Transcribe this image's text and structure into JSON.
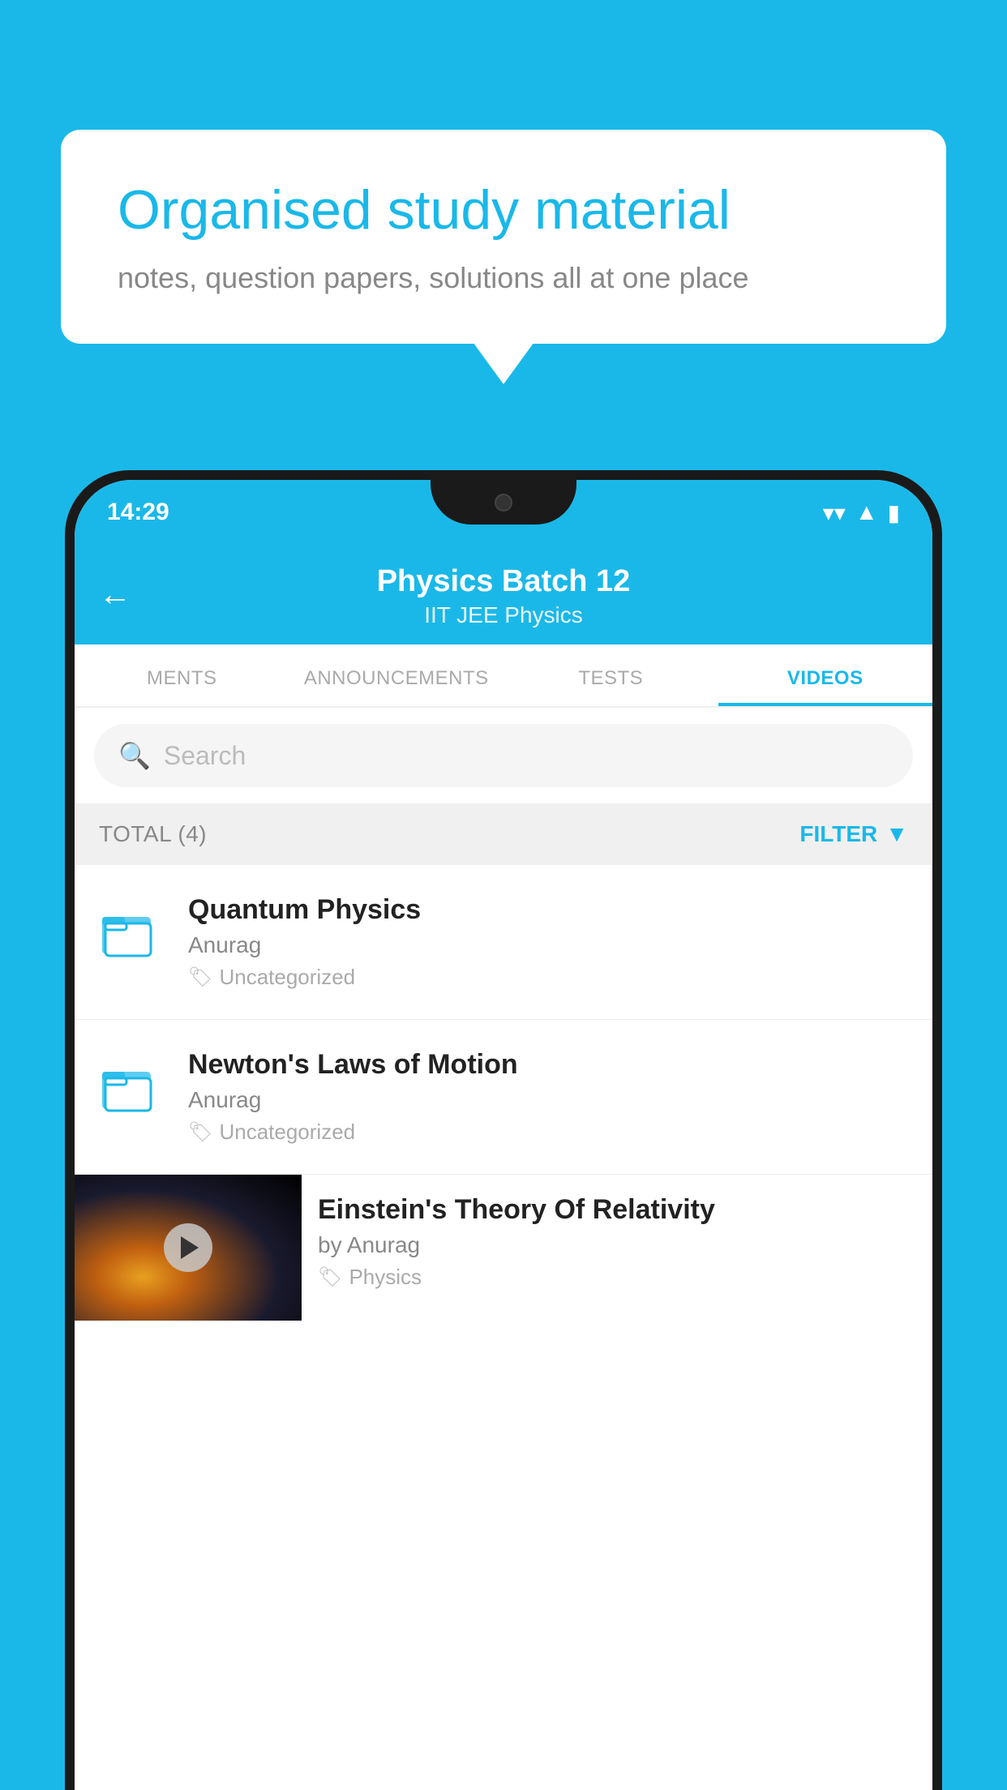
{
  "background": {
    "color": "#1ab8e8"
  },
  "bubble": {
    "title": "Organised study material",
    "subtitle": "notes, question papers, solutions all at one place"
  },
  "phone": {
    "status_bar": {
      "time": "14:29",
      "icons": [
        "wifi",
        "signal",
        "battery"
      ]
    },
    "header": {
      "title": "Physics Batch 12",
      "subtitle": "IIT JEE   Physics",
      "back_label": "←"
    },
    "tabs": [
      {
        "label": "MENTS",
        "active": false
      },
      {
        "label": "ANNOUNCEMENTS",
        "active": false
      },
      {
        "label": "TESTS",
        "active": false
      },
      {
        "label": "VIDEOS",
        "active": true
      }
    ],
    "search": {
      "placeholder": "Search"
    },
    "filter_bar": {
      "total": "TOTAL (4)",
      "filter_label": "FILTER"
    },
    "list_items": [
      {
        "title": "Quantum Physics",
        "author": "Anurag",
        "tag": "Uncategorized",
        "has_thumbnail": false
      },
      {
        "title": "Newton's Laws of Motion",
        "author": "Anurag",
        "tag": "Uncategorized",
        "has_thumbnail": false
      },
      {
        "title": "Einstein's Theory Of Relativity",
        "author": "by Anurag",
        "tag": "Physics",
        "has_thumbnail": true
      }
    ]
  }
}
